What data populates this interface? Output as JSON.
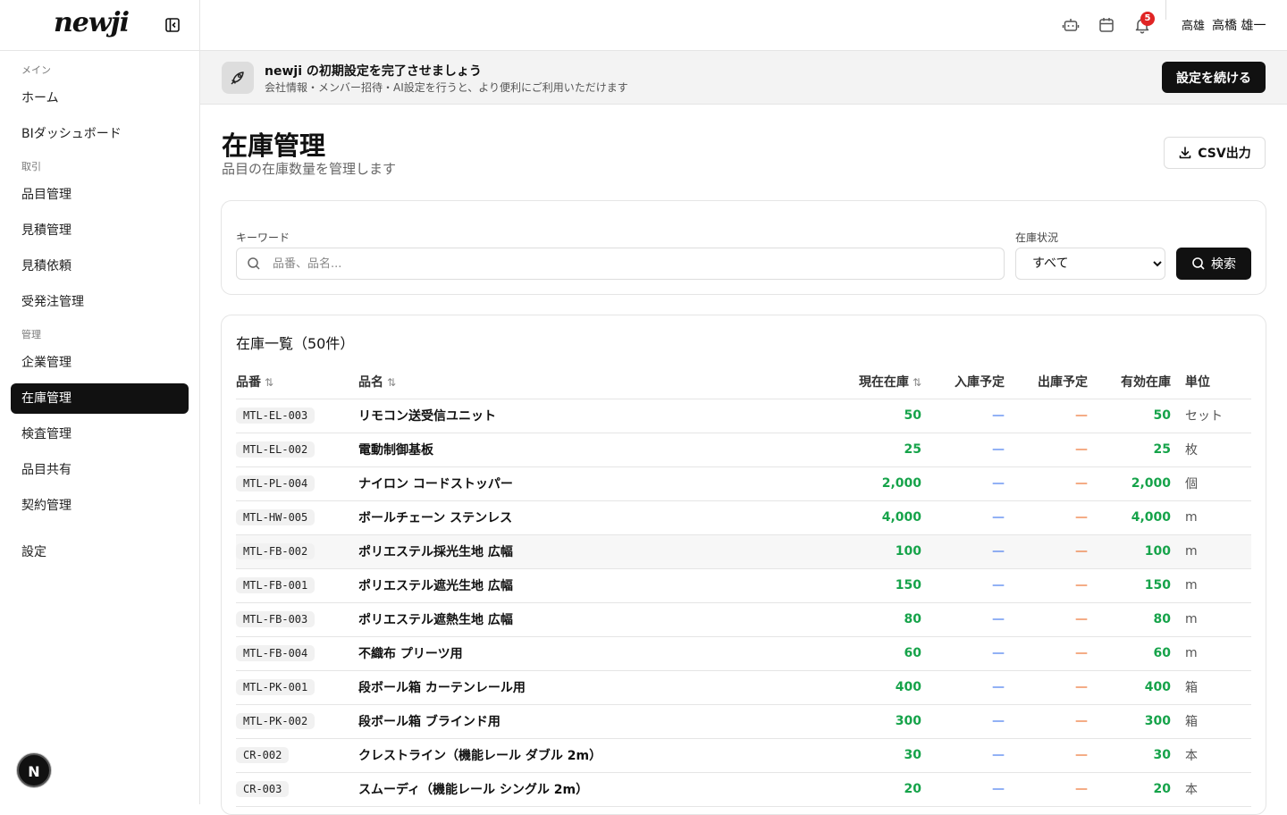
{
  "sidebar": {
    "logo": "newji",
    "sections": [
      {
        "title": "メイン",
        "items": [
          "ホーム",
          "BIダッシュボード"
        ]
      },
      {
        "title": "取引",
        "items": [
          "品目管理",
          "見積管理",
          "見積依頼",
          "受発注管理"
        ]
      },
      {
        "title": "管理",
        "items": [
          "企業管理",
          "在庫管理",
          "検査管理",
          "品目共有",
          "契約管理"
        ]
      }
    ],
    "settings": "設定",
    "active": "在庫管理",
    "avatar_letter": "N"
  },
  "topbar": {
    "notification_count": "5",
    "location": "高雄",
    "user_name": "高橋 雄一"
  },
  "banner": {
    "title": "newji の初期設定を完了させましょう",
    "subtitle": "会社情報・メンバー招待・AI設定を行うと、より便利にご利用いただけます",
    "button": "設定を続ける"
  },
  "page": {
    "title": "在庫管理",
    "subtitle": "品目の在庫数量を管理します",
    "csv_button": "CSV出力"
  },
  "filter": {
    "keyword_label": "キーワード",
    "keyword_placeholder": "品番、品名...",
    "status_label": "在庫状況",
    "status_value": "すべて",
    "search_button": "検索"
  },
  "table": {
    "title": "在庫一覧（50件）",
    "headers": {
      "code": "品番",
      "name": "品名",
      "current": "現在在庫",
      "incoming": "入庫予定",
      "outgoing": "出庫予定",
      "available": "有効在庫",
      "unit": "単位"
    },
    "rows": [
      {
        "code": "MTL-EL-003",
        "name": "リモコン送受信ユニット",
        "current": "50",
        "incoming": "—",
        "outgoing": "—",
        "available": "50",
        "unit": "セット"
      },
      {
        "code": "MTL-EL-002",
        "name": "電動制御基板",
        "current": "25",
        "incoming": "—",
        "outgoing": "—",
        "available": "25",
        "unit": "枚"
      },
      {
        "code": "MTL-PL-004",
        "name": "ナイロン コードストッパー",
        "current": "2,000",
        "incoming": "—",
        "outgoing": "—",
        "available": "2,000",
        "unit": "個"
      },
      {
        "code": "MTL-HW-005",
        "name": "ボールチェーン ステンレス",
        "current": "4,000",
        "incoming": "—",
        "outgoing": "—",
        "available": "4,000",
        "unit": "m"
      },
      {
        "code": "MTL-FB-002",
        "name": "ポリエステル採光生地 広幅",
        "current": "100",
        "incoming": "—",
        "outgoing": "—",
        "available": "100",
        "unit": "m"
      },
      {
        "code": "MTL-FB-001",
        "name": "ポリエステル遮光生地 広幅",
        "current": "150",
        "incoming": "—",
        "outgoing": "—",
        "available": "150",
        "unit": "m"
      },
      {
        "code": "MTL-FB-003",
        "name": "ポリエステル遮熱生地 広幅",
        "current": "80",
        "incoming": "—",
        "outgoing": "—",
        "available": "80",
        "unit": "m"
      },
      {
        "code": "MTL-FB-004",
        "name": "不織布 プリーツ用",
        "current": "60",
        "incoming": "—",
        "outgoing": "—",
        "available": "60",
        "unit": "m"
      },
      {
        "code": "MTL-PK-001",
        "name": "段ボール箱 カーテンレール用",
        "current": "400",
        "incoming": "—",
        "outgoing": "—",
        "available": "400",
        "unit": "箱"
      },
      {
        "code": "MTL-PK-002",
        "name": "段ボール箱 ブラインド用",
        "current": "300",
        "incoming": "—",
        "outgoing": "—",
        "available": "300",
        "unit": "箱"
      },
      {
        "code": "CR-002",
        "name": "クレストライン（機能レール ダブル 2m）",
        "current": "30",
        "incoming": "—",
        "outgoing": "—",
        "available": "30",
        "unit": "本"
      },
      {
        "code": "CR-003",
        "name": "スムーディ（機能レール シングル 2m）",
        "current": "20",
        "incoming": "—",
        "outgoing": "—",
        "available": "20",
        "unit": "本"
      }
    ]
  },
  "colors": {
    "accent": "#111111",
    "stock_green": "#16a34a",
    "incoming_blue": "#2563eb",
    "outgoing_orange": "#ea580c",
    "badge_red": "#e02424"
  }
}
